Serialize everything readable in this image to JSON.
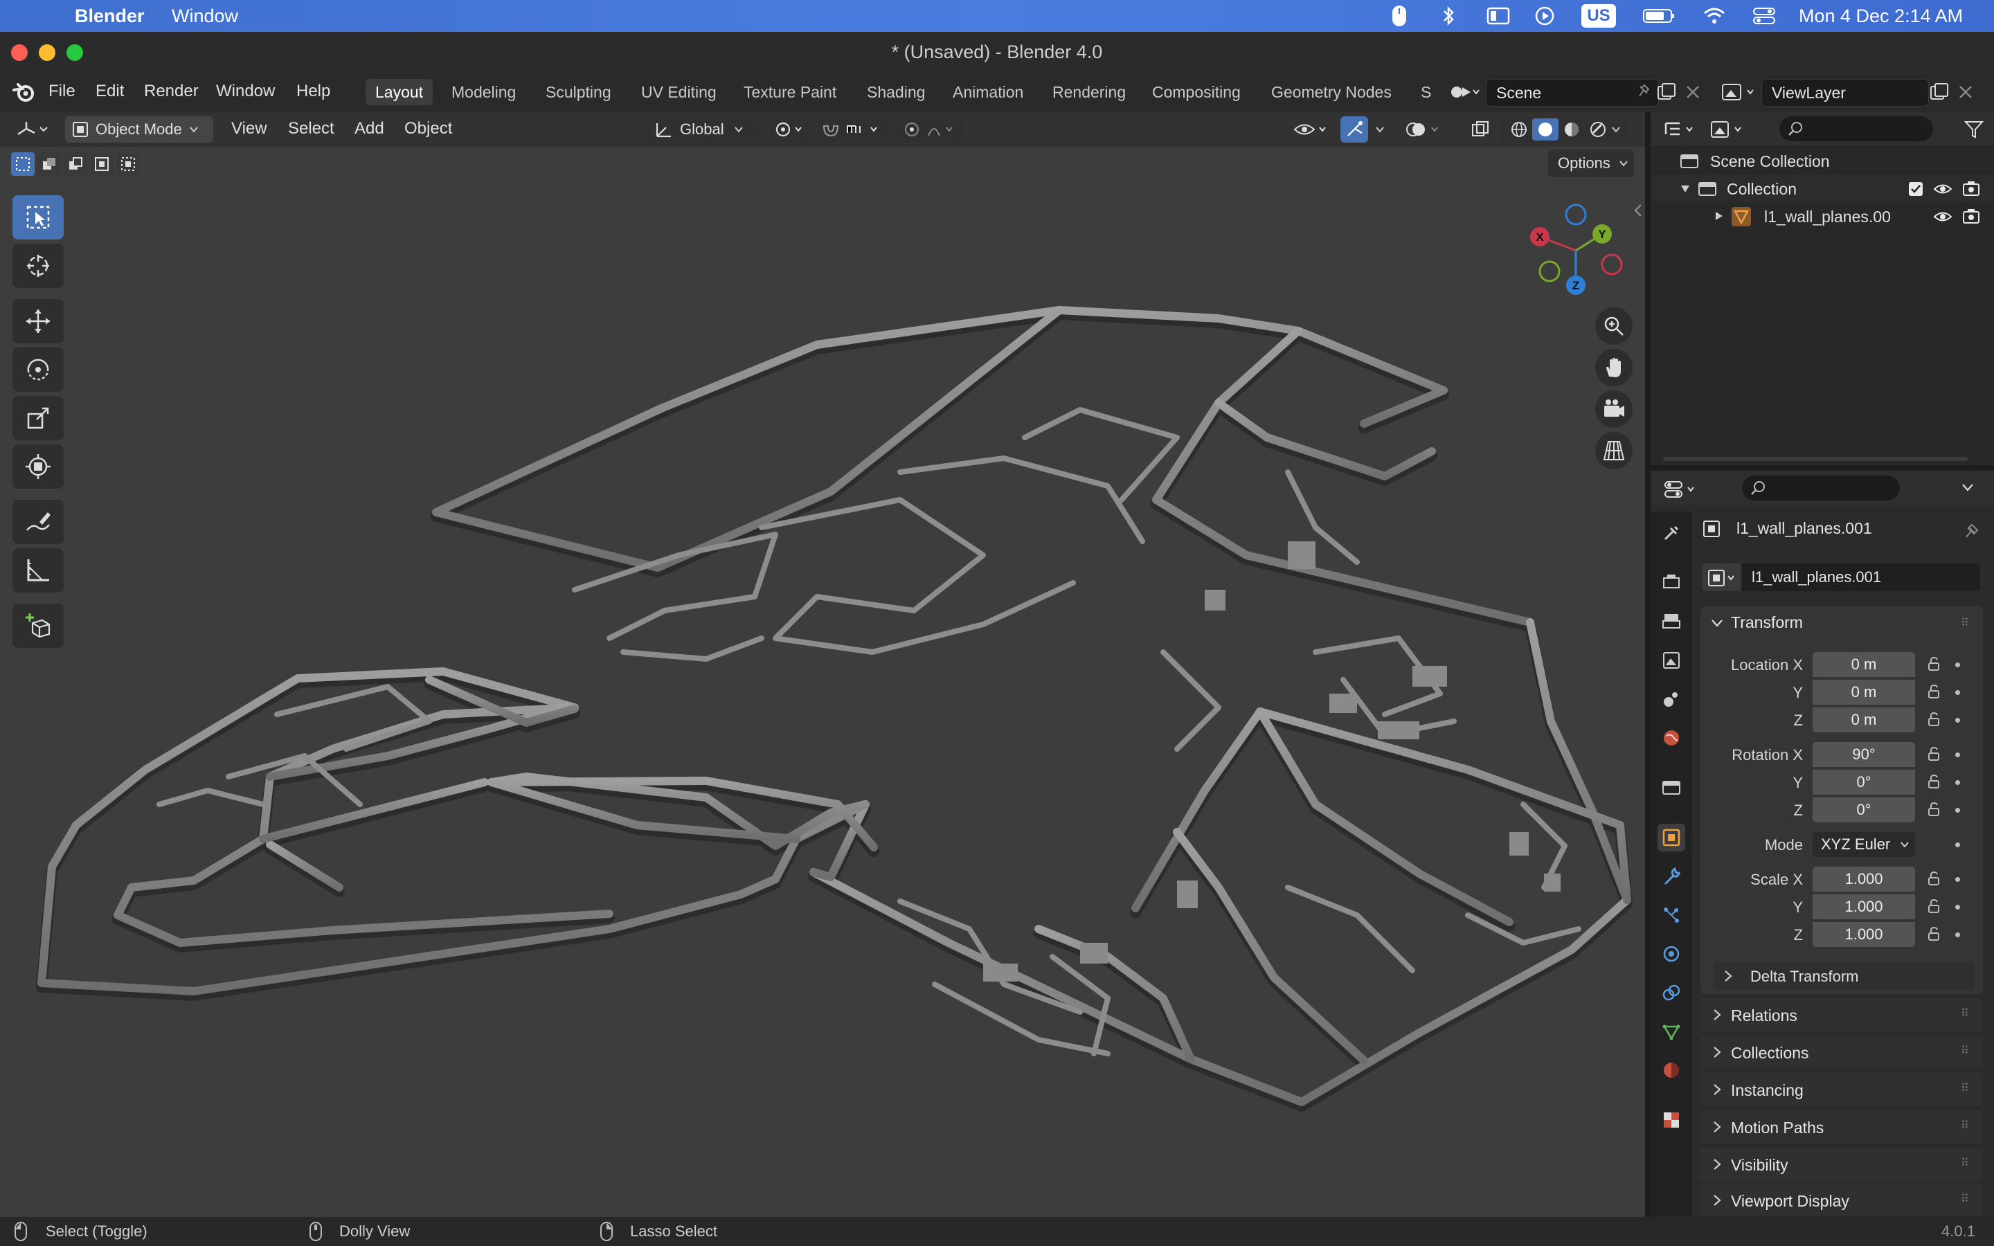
{
  "macos": {
    "app_name": "Blender",
    "menu_window": "Window",
    "input_source": "US",
    "datetime": "Mon 4 Dec  2:14 AM"
  },
  "window": {
    "title": "* (Unsaved) - Blender 4.0"
  },
  "topbar": {
    "menus": [
      "File",
      "Edit",
      "Render",
      "Window",
      "Help"
    ],
    "workspaces": [
      "Layout",
      "Modeling",
      "Sculpting",
      "UV Editing",
      "Texture Paint",
      "Shading",
      "Animation",
      "Rendering",
      "Compositing",
      "Geometry Nodes",
      "S"
    ],
    "active_workspace": "Layout",
    "scene": "Scene",
    "view_layer": "ViewLayer"
  },
  "viewport": {
    "mode": "Object Mode",
    "menus": [
      "View",
      "Select",
      "Add",
      "Object"
    ],
    "transform_orientation": "Global",
    "options_label": "Options",
    "gizmo_axes": [
      "X",
      "Y",
      "Z"
    ]
  },
  "outliner": {
    "scene_collection": "Scene Collection",
    "collection": "Collection",
    "object": "l1_wall_planes.00"
  },
  "properties": {
    "object_name": "l1_wall_planes.001",
    "object_field": "l1_wall_planes.001",
    "transform": {
      "header": "Transform",
      "location_label": "Location X",
      "y_label": "Y",
      "z_label": "Z",
      "location": [
        "0 m",
        "0 m",
        "0 m"
      ],
      "rotation_label": "Rotation X",
      "rotation": [
        "90°",
        "0°",
        "0°"
      ],
      "mode_label": "Mode",
      "mode_value": "XYZ Euler",
      "scale_label": "Scale X",
      "scale": [
        "1.000",
        "1.000",
        "1.000"
      ],
      "delta": "Delta Transform"
    },
    "panels": [
      "Relations",
      "Collections",
      "Instancing",
      "Motion Paths",
      "Visibility",
      "Viewport Display"
    ]
  },
  "statusbar": {
    "left": "Select (Toggle)",
    "middle": "Dolly View",
    "right": "Lasso Select",
    "version": "4.0.1"
  },
  "colors": {
    "accent": "#4772b3",
    "axis_x": "#c9384a",
    "axis_y": "#79a82a",
    "axis_z": "#2f7fd6",
    "viewport_bg": "#3d3d3d"
  }
}
